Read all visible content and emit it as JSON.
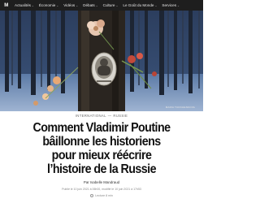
{
  "nav": {
    "logo_text": "M",
    "items": [
      {
        "label": "Actualités",
        "has_menu": true
      },
      {
        "label": "Économie",
        "has_menu": true
      },
      {
        "label": "Vidéos",
        "has_menu": true
      },
      {
        "label": "Débats",
        "has_menu": true
      },
      {
        "label": "Culture",
        "has_menu": true
      },
      {
        "label": "Le Goût du Monde",
        "has_menu": true
      },
      {
        "label": "Services",
        "has_menu": true
      }
    ]
  },
  "hero": {
    "credit": "MARIA TURCHENKOVA"
  },
  "article": {
    "section": "INTERNATIONAL",
    "subsection": "RUSSIE",
    "title_lines": [
      "Comment Vladimir Poutine",
      "bâillonne les historiens",
      "pour mieux réécrire",
      "l’histoire de la Russie"
    ],
    "byline": "Par Isabelle Mandraud",
    "meta": "Publié le 10 juin 2021 à 06h00, modifié le 10 juin 2021 à 17h53",
    "read_time": "Lecture 8 min"
  },
  "colors": {
    "navbar": "#1e1e1e",
    "headline": "#111111"
  }
}
